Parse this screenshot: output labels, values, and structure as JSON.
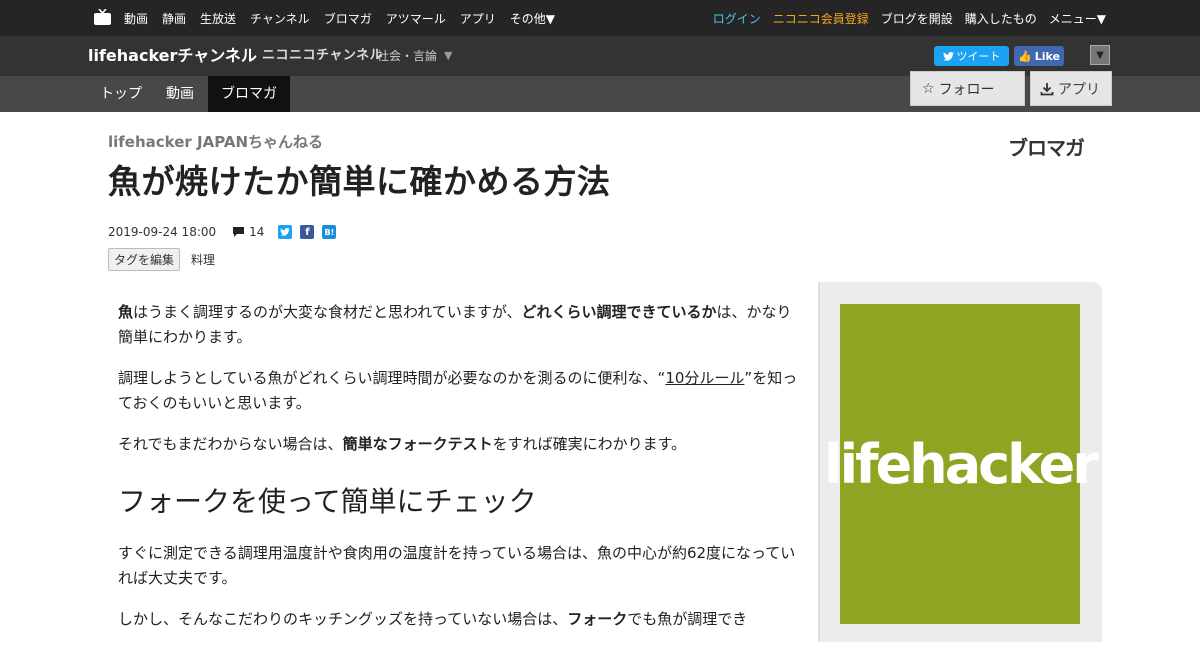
{
  "topbar": {
    "left_items": [
      "動画",
      "静画",
      "生放送",
      "チャンネル",
      "ブロマガ",
      "アツマール",
      "アプリ",
      "その他▼"
    ],
    "login": "ログイン",
    "register": "ニコニコ会員登録",
    "open_blog": "ブログを開設",
    "purchased": "購入したもの",
    "menu": "メニュー▼"
  },
  "channel": {
    "name": "lifehackerチャンネル",
    "brand": "ニコニコチャンネル",
    "category": "社会・言論",
    "caret": "▼",
    "tweet": "ツイート",
    "like": "Like",
    "dropdown": "▼"
  },
  "nav": {
    "tabs": [
      "トップ",
      "動画",
      "ブロマガ"
    ],
    "follow": "フォロー",
    "app": "アプリ"
  },
  "article": {
    "channel_sub": "lifehacker JAPANちゃんねる",
    "blomaga_logo": "ブロマガ",
    "title": "魚が焼けたか簡単に確かめる方法",
    "date": "2019-09-24 18:00",
    "comments": "14",
    "tag_edit": "タグを編集",
    "tags": [
      "料理"
    ],
    "p1_bold1": "魚",
    "p1_text1": "はうまく調理するのが大変な食材だと思われていますが、",
    "p1_bold2": "どれくらい調理できているか",
    "p1_text2": "は、かなり簡単にわかります。",
    "p2_text1": "調理しようとしている魚がどれくらい調理時間が必要なのかを測るのに便利な、“",
    "p2_link": "10分ルール",
    "p2_text2": "”を知っておくのもいいと思います。",
    "p3_text1": "それでもまだわからない場合は、",
    "p3_bold": "簡単なフォークテスト",
    "p3_text2": "をすれば確実にわかります。",
    "h2": "フォークを使って簡単にチェック",
    "p4": "すぐに測定できる調理用温度計や食肉用の温度計を持っている場合は、魚の中心が約62度になっていれば大丈夫です。",
    "p5_text1": "しかし、そんなこだわりのキッチングッズを持っていない場合は、",
    "p5_bold": "フォーク",
    "p5_text2": "でも魚が調理でき"
  },
  "sidebar": {
    "logo_text": "lifehacker",
    "logo_color": "#8ea422"
  },
  "colors": {
    "topbar": "#252525",
    "chanbar": "#333333",
    "navbar": "#484848",
    "login": "#4fc3e8",
    "register": "#f5a623",
    "twitter": "#1da1f2",
    "facebook": "#4267b2"
  }
}
